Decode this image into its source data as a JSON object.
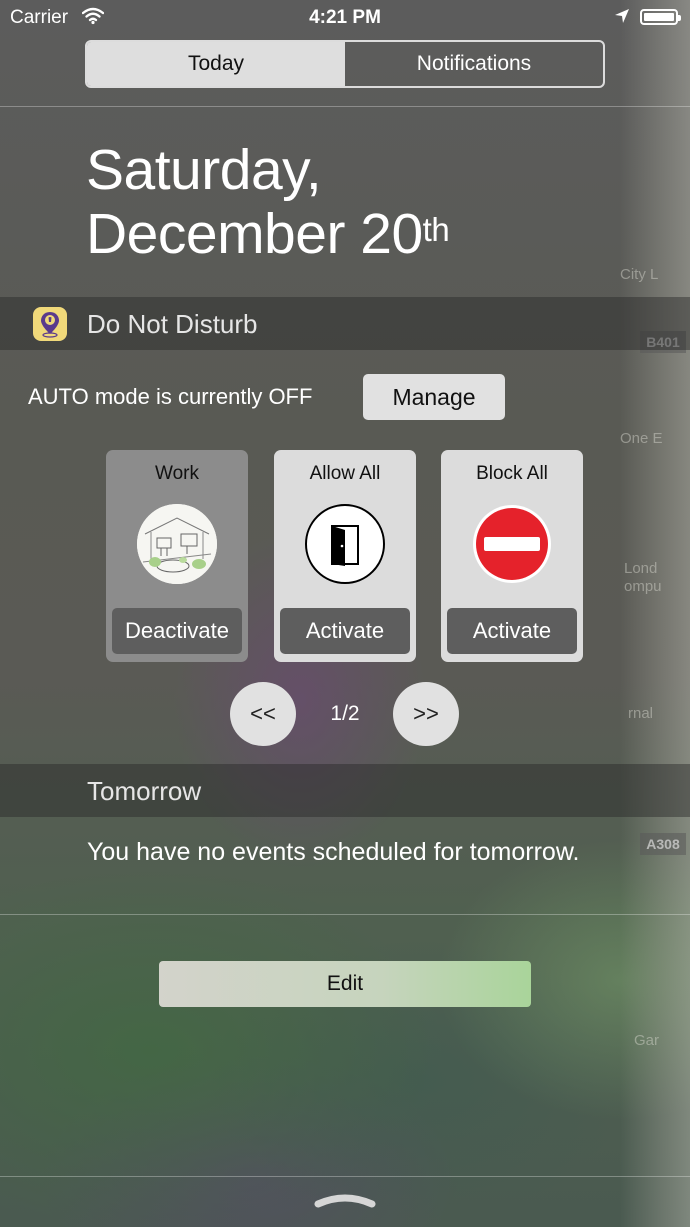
{
  "status_bar": {
    "carrier": "Carrier",
    "time": "4:21 PM"
  },
  "tabs": [
    {
      "label": "Today",
      "active": true
    },
    {
      "label": "Notifications",
      "active": false
    }
  ],
  "date": {
    "line1": "Saturday,",
    "line2": "December 20",
    "suffix": "th"
  },
  "dnd_widget": {
    "title": "Do Not Disturb",
    "auto_mode_text": "AUTO mode is currently OFF",
    "manage_label": "Manage",
    "profiles": [
      {
        "name": "Work",
        "action": "Deactivate",
        "icon": "office-sketch-icon",
        "selected": true
      },
      {
        "name": "Allow All",
        "action": "Activate",
        "icon": "open-door-icon",
        "selected": false
      },
      {
        "name": "Block All",
        "action": "Activate",
        "icon": "no-entry-icon",
        "selected": false
      }
    ],
    "pager": {
      "prev_label": "<<",
      "page_text": "1/2",
      "next_label": ">>"
    }
  },
  "tomorrow": {
    "title": "Tomorrow",
    "message": "You have no events scheduled for tomorrow."
  },
  "edit_label": "Edit",
  "background_map_labels": [
    "City L",
    "B401",
    "One E",
    "Lond",
    "ompu",
    "rnal",
    "A308",
    "Gar"
  ],
  "colors": {
    "no_entry_red": "#e5222b",
    "app_icon_yellow": "#f1d97a",
    "app_icon_purple": "#5b3a8c"
  }
}
